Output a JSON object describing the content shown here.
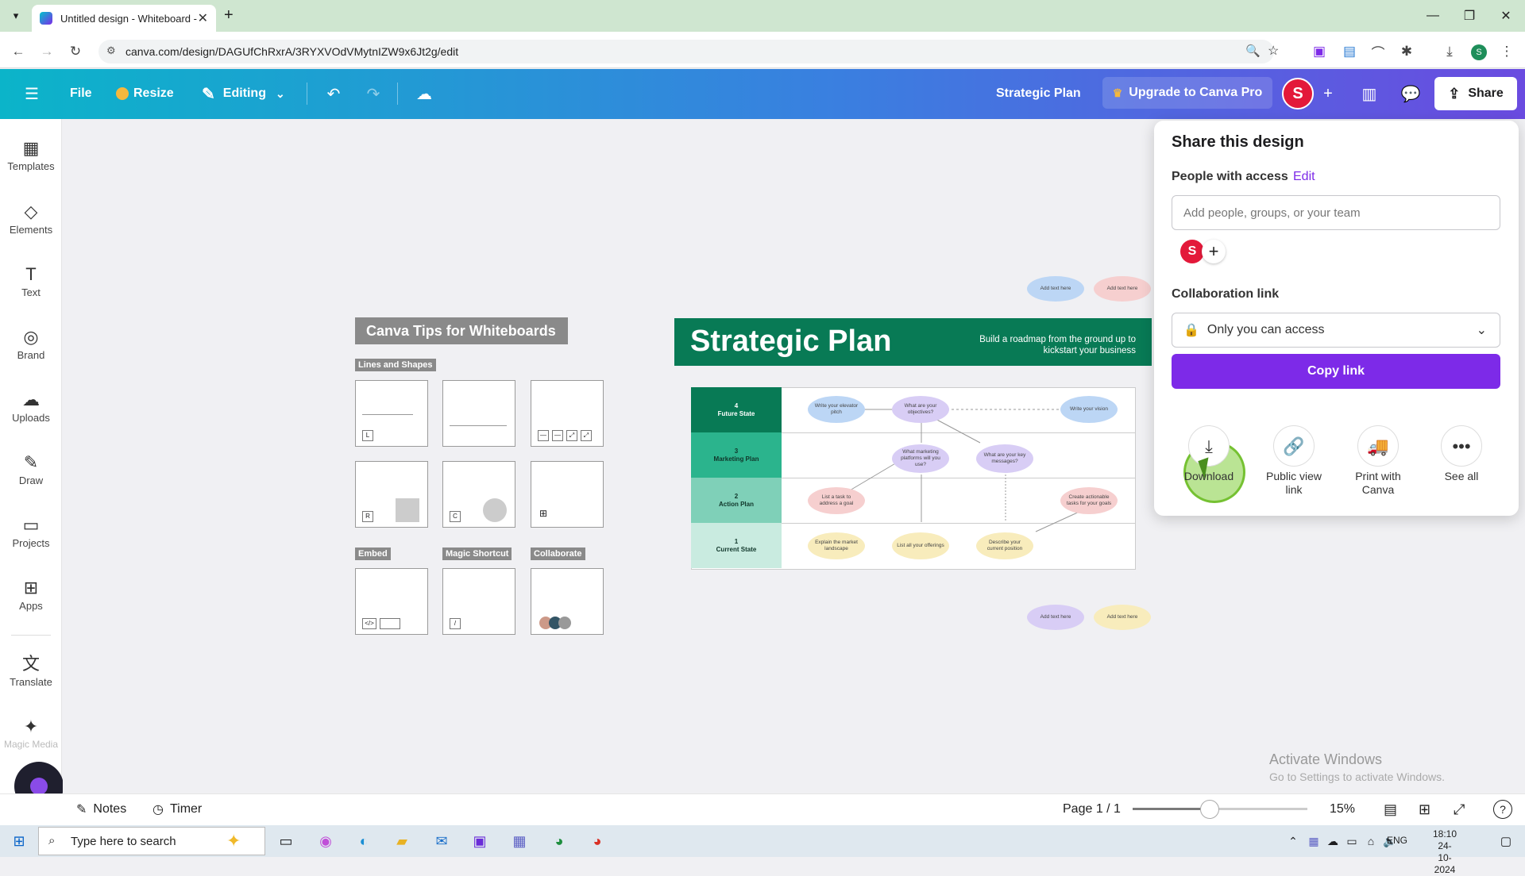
{
  "browser": {
    "tab_title": "Untitled design - Whiteboard -",
    "url": "canva.com/design/DAGUfChRxrA/3RYXVOdVMytnIZW9x6Jt2g/edit"
  },
  "header": {
    "file": "File",
    "resize": "Resize",
    "editing": "Editing",
    "design_title": "Strategic Plan",
    "upgrade": "Upgrade to Canva Pro",
    "avatar_initial": "S",
    "share": "Share"
  },
  "sidebar": {
    "items": [
      {
        "label": "Templates",
        "icon": "templates-icon"
      },
      {
        "label": "Elements",
        "icon": "elements-icon"
      },
      {
        "label": "Text",
        "icon": "text-icon"
      },
      {
        "label": "Brand",
        "icon": "brand-icon"
      },
      {
        "label": "Uploads",
        "icon": "uploads-icon"
      },
      {
        "label": "Draw",
        "icon": "draw-icon"
      },
      {
        "label": "Projects",
        "icon": "projects-icon"
      },
      {
        "label": "Apps",
        "icon": "apps-icon"
      },
      {
        "label": "Translate",
        "icon": "translate-icon"
      },
      {
        "label": "Magic Media",
        "icon": "magic-media-icon"
      }
    ]
  },
  "tips": {
    "title": "Canva Tips for Whiteboards",
    "lines_shapes": "Lines and Shapes",
    "embed": "Embed",
    "magic_shortcut": "Magic Shortcut",
    "collaborate": "Collaborate"
  },
  "plan": {
    "title": "Strategic Plan",
    "subtitle": "Build a roadmap from the ground up to kickstart your business",
    "rows": [
      {
        "num": "4",
        "label": "Future State"
      },
      {
        "num": "3",
        "label": "Marketing Plan"
      },
      {
        "num": "2",
        "label": "Action Plan"
      },
      {
        "num": "1",
        "label": "Current State"
      }
    ],
    "ovals": {
      "o1": "Write your elevator pitch",
      "o2": "What are your objectives?",
      "o3": "Write your vision",
      "o4": "What marketing platforms will you use?",
      "o5": "What are your key messages?",
      "o6": "List a task to address a goal",
      "o7": "Create actionable tasks for your goals",
      "o8": "Explain the market landscape",
      "o9": "List all your offerings",
      "o10": "Describe your current position"
    },
    "add_text": "Add text here"
  },
  "share_panel": {
    "title": "Share this design",
    "people_access": "People with access",
    "edit": "Edit",
    "input_placeholder": "Add people, groups, or your team",
    "avatar_initial": "S",
    "collab_link": "Collaboration link",
    "access_level": "Only you can access",
    "copy_link": "Copy link",
    "options": [
      {
        "label": "Download",
        "icon": "download-icon"
      },
      {
        "label": "Public view link",
        "icon": "link-icon"
      },
      {
        "label": "Print with Canva",
        "icon": "truck-icon"
      },
      {
        "label": "See all",
        "icon": "more-icon"
      }
    ]
  },
  "bottom": {
    "notes": "Notes",
    "timer": "Timer",
    "page": "Page 1 / 1",
    "zoom": "15%",
    "zoom_fraction": 0.44
  },
  "watermark": {
    "line1": "Activate Windows",
    "line2": "Go to Settings to activate Windows."
  },
  "taskbar": {
    "search_placeholder": "Type here to search",
    "lang": "ENG",
    "time": "18:10",
    "date": "24-10-2024"
  },
  "colors": {
    "accent": "#7d2ae8",
    "plan_green": "#087a55",
    "avatar_red": "#e3193a"
  }
}
